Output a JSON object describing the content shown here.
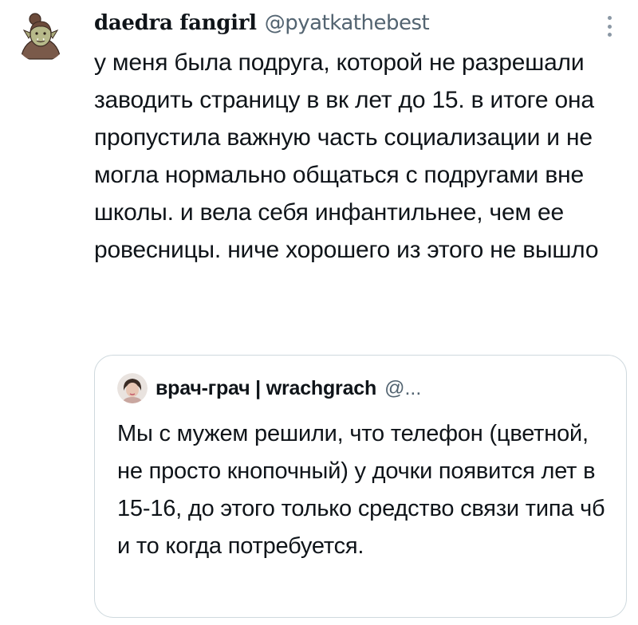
{
  "tweet": {
    "author": {
      "display_name": "daedra fangirl",
      "handle": "@pyatkathebest",
      "avatar_icon": "orc-avatar-icon"
    },
    "text": "у меня была подруга, которой не разрешали заводить страницу в вк лет до 15. в итоге она пропустила важную часть социализации и не могла нормально общаться с подругами вне школы. и вела себя инфантильнее, чем ее ровесницы. ниче хорошего из этого не вышло",
    "more_icon": "more-vertical-icon"
  },
  "quote": {
    "author": {
      "display_name": "врач-грач | wrachgrach",
      "handle": "@...",
      "avatar_icon": "user-avatar-icon"
    },
    "text": "Мы с мужем решили, что телефон (цветной, не просто кнопочный) у дочки появится лет в 15-16, до этого только средство связи типа чб и то когда потребуется."
  },
  "colors": {
    "text_primary": "#0f1419",
    "text_secondary": "#536471",
    "border": "#cfd9de",
    "background": "#ffffff"
  }
}
